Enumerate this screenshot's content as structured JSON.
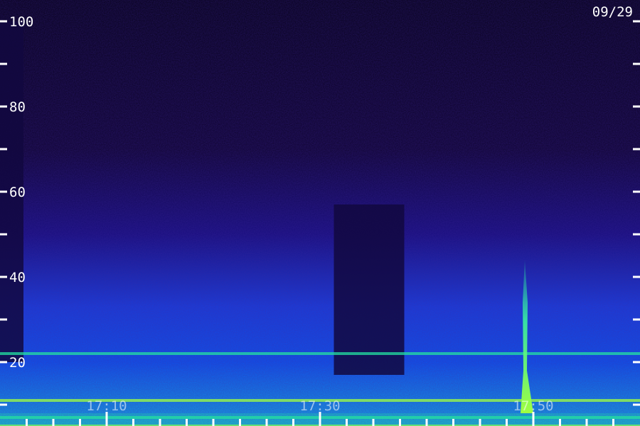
{
  "chart_data": {
    "type": "heatmap",
    "title": "",
    "date_label": "09/29",
    "xlabel": "",
    "ylabel": "",
    "ylim": [
      0,
      100
    ],
    "y_ticks": [
      20,
      40,
      60,
      80,
      100
    ],
    "y_minor_ticks": [
      10,
      30,
      50,
      70,
      90
    ],
    "x_ticks": [
      {
        "label": "17:10",
        "minute": 10
      },
      {
        "label": "17:30",
        "minute": 30
      },
      {
        "label": "17:50",
        "minute": 50
      }
    ],
    "x_minor_minutes": [
      0,
      2.5,
      5,
      7.5,
      12.5,
      15,
      17.5,
      20,
      22.5,
      25,
      27.5,
      32.5,
      35,
      37.5,
      40,
      42.5,
      45,
      47.5,
      52.5,
      55,
      57.5
    ],
    "colors": {
      "background": "#0a0420",
      "low": "#14083f",
      "mid": "#1a3cd8",
      "high": "#24e0a0",
      "peak": "#a0ff40"
    },
    "features": [
      {
        "kind": "data_gap",
        "start_minute": 0,
        "end_minute": 2.2,
        "y_from": 20,
        "y_to": 100
      },
      {
        "kind": "data_gap",
        "start_minute": 31.3,
        "end_minute": 37.9,
        "y_from": 17,
        "y_to": 57
      },
      {
        "kind": "horizontal_line",
        "y": 22,
        "intensity": "high"
      },
      {
        "kind": "horizontal_line",
        "y": 11,
        "intensity": "peak"
      },
      {
        "kind": "horizontal_line",
        "y": 7,
        "intensity": "high"
      },
      {
        "kind": "horizontal_line",
        "y": 5,
        "intensity": "peak"
      },
      {
        "kind": "vertical_emission",
        "minute": 49.2,
        "y_from": 8,
        "y_to": 44,
        "intensity": "peak"
      }
    ]
  }
}
